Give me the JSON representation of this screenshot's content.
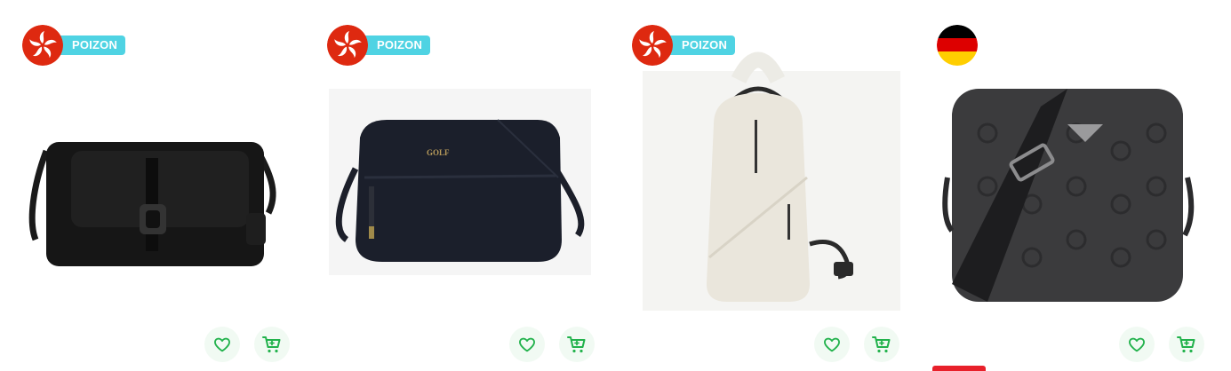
{
  "colors": {
    "accent_green": "#22b24c",
    "badge_cyan": "#4fd3e3",
    "hk_red": "#de2910",
    "sale_red": "#e8202a"
  },
  "products": [
    {
      "origin": "hong-kong",
      "flag_icon": "hong-kong-flag-icon",
      "badge": "POIZON",
      "image": "black-leather-crossbody-bag",
      "favorite_icon": "heart-icon",
      "cart_icon": "cart-icon"
    },
    {
      "origin": "hong-kong",
      "flag_icon": "hong-kong-flag-icon",
      "badge": "POIZON",
      "image": "navy-golf-messenger-bag",
      "brand_mark": "GOLF",
      "favorite_icon": "heart-icon",
      "cart_icon": "cart-icon"
    },
    {
      "origin": "hong-kong",
      "flag_icon": "hong-kong-flag-icon",
      "badge": "POIZON",
      "image": "cream-sling-backpack",
      "favorite_icon": "heart-icon",
      "cart_icon": "cart-icon"
    },
    {
      "origin": "germany",
      "flag_icon": "germany-flag-icon",
      "badge": "",
      "image": "guess-monogram-crossbody-bag",
      "favorite_icon": "heart-icon",
      "cart_icon": "cart-icon"
    }
  ]
}
